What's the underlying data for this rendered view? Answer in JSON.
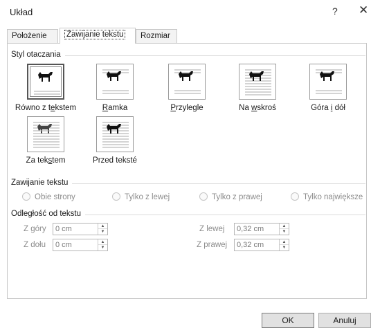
{
  "window": {
    "title": "Układ",
    "help_label": "?",
    "close_label": "✕"
  },
  "tabs": [
    {
      "label": "Położenie",
      "active": false
    },
    {
      "label": "Zawijanie tekstu",
      "active": true
    },
    {
      "label": "Rozmiar",
      "active": false
    }
  ],
  "wrap_style": {
    "group_label": "Styl otaczania",
    "options": [
      {
        "label_pre": "Równo z t",
        "label_u": "e",
        "label_post": "kstem",
        "icon": "inline-with-text-icon",
        "selected": true
      },
      {
        "label_pre": "",
        "label_u": "R",
        "label_post": "amka",
        "icon": "square-wrap-icon",
        "selected": false
      },
      {
        "label_pre": "",
        "label_u": "P",
        "label_post": "rzylegle",
        "icon": "tight-wrap-icon",
        "selected": false
      },
      {
        "label_pre": "Na ",
        "label_u": "w",
        "label_post": "skroś",
        "icon": "through-wrap-icon",
        "selected": false
      },
      {
        "label_pre": "Góra ",
        "label_u": "i",
        "label_post": " dół",
        "icon": "top-bottom-wrap-icon",
        "selected": false
      },
      {
        "label_pre": "Za tek",
        "label_u": "s",
        "label_post": "tem",
        "icon": "behind-text-icon",
        "selected": false
      },
      {
        "label_pre": "Przed teksté",
        "label_u": "",
        "label_post": "",
        "icon": "in-front-of-text-icon",
        "selected": false
      }
    ]
  },
  "wrap_text": {
    "group_label": "Zawijanie tekstu",
    "options": [
      "Obie strony",
      "Tylko z lewej",
      "Tylko z prawej",
      "Tylko największe"
    ]
  },
  "distance": {
    "group_label": "Odległość od tekstu",
    "top_label": "Z góry",
    "top_value": "0 cm",
    "bottom_label": "Z dołu",
    "bottom_value": "0 cm",
    "left_label": "Z lewej",
    "left_value": "0,32 cm",
    "right_label": "Z prawej",
    "right_value": "0,32 cm"
  },
  "buttons": {
    "ok": "OK",
    "cancel": "Anuluj"
  },
  "colors": {
    "text": "#1a1a1a",
    "disabled_text": "#8c8c8c",
    "border": "#c7c7c7"
  }
}
